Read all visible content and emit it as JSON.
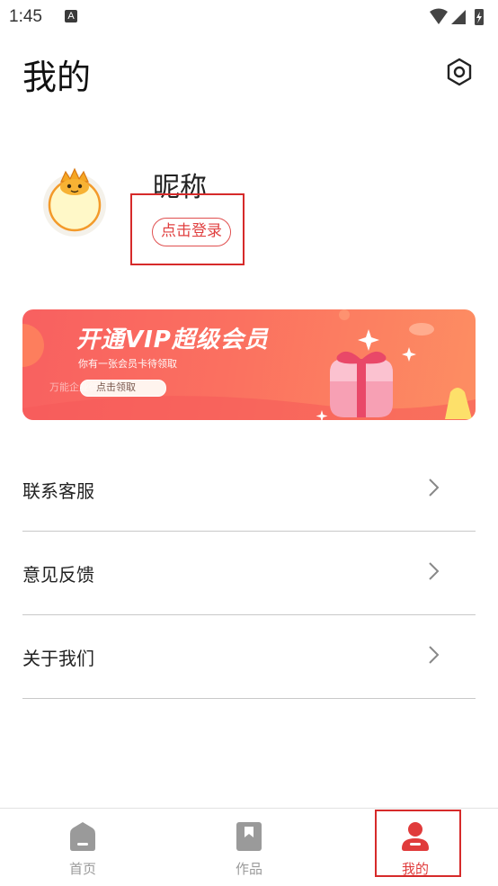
{
  "status_bar": {
    "time": "1:45",
    "notification_badge": "A"
  },
  "header": {
    "title": "我的",
    "settings_icon": "gear-icon"
  },
  "profile": {
    "nickname": "昵称",
    "login_label": "点击登录",
    "avatar_icon": "crown-mascot-avatar"
  },
  "vip_banner": {
    "title": "开通VIP超级会员",
    "subtitle": "你有一张会员卡待领取",
    "claim_label": "点击领取",
    "watermark": "万能企业微信下载"
  },
  "menu": [
    {
      "label": "联系客服"
    },
    {
      "label": "意见反馈"
    },
    {
      "label": "关于我们"
    }
  ],
  "bottom_nav": [
    {
      "label": "首页",
      "icon": "home-icon",
      "active": false
    },
    {
      "label": "作品",
      "icon": "bookmark-icon",
      "active": false
    },
    {
      "label": "我的",
      "icon": "user-icon",
      "active": true
    }
  ],
  "colors": {
    "accent": "#e03b3b",
    "banner_start": "#f86060",
    "banner_end": "#fd8e62",
    "inactive": "#9a9a9a"
  }
}
